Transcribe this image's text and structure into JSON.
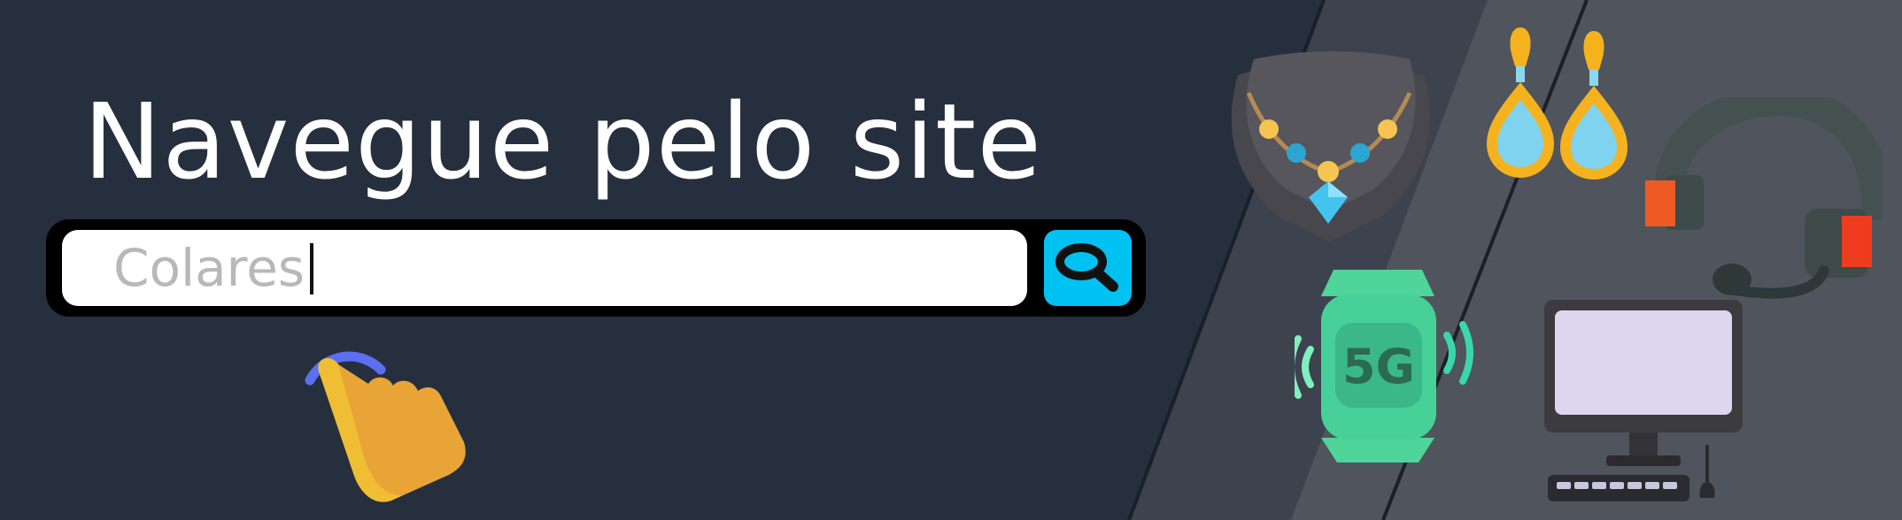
{
  "banner": {
    "headline": "Navegue pelo site",
    "search": {
      "value": "Colares"
    },
    "colors": {
      "background_dark": "#262f3e",
      "background_slate": "#3d434e",
      "background_gray": "#50545c",
      "headline_text": "#ffffff",
      "search_button": "#00c2f2",
      "placeholder_text": "#b8b8b8"
    },
    "icons": [
      "pointing-hand-icon",
      "necklace-icon",
      "earrings-icon",
      "headset-icon",
      "smartwatch-5g-icon",
      "desktop-computer-icon"
    ],
    "smartwatch_label": "5G"
  }
}
